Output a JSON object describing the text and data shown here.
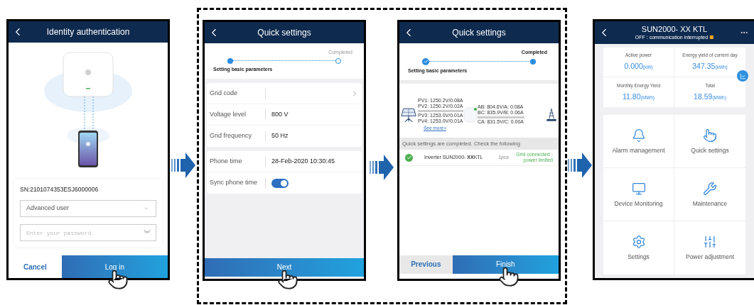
{
  "screens": [
    {
      "kind": "login",
      "title": "Identity authentication",
      "sn": "SN:2101074353ESJ6000006",
      "user_type": "Advanced user",
      "password": {
        "placeholder": "Enter your password."
      },
      "buttons": [
        {
          "label": "Cancel",
          "primary": false,
          "tapped": false
        },
        {
          "label": "Log in",
          "primary": true,
          "tapped": true
        }
      ]
    },
    {
      "kind": "settings",
      "title": "Quick settings",
      "steps": [
        {
          "label": "Setting basic parameters",
          "done": false,
          "active": true
        },
        {
          "label": "Completed",
          "done": false,
          "active": false
        }
      ],
      "groups": [
        {
          "rows": [
            {
              "kind": "link",
              "label": "Grid code"
            },
            {
              "kind": "value",
              "label": "Voltage level",
              "value": "800 V"
            },
            {
              "kind": "value",
              "label": "Grid frequency",
              "value": "50 Hz"
            }
          ]
        },
        {
          "rows": [
            {
              "kind": "value",
              "label": "Phone time",
              "value": "28-Feb-2020 10:30:45"
            },
            {
              "kind": "toggle",
              "label": "Sync phone time",
              "on": true
            }
          ]
        }
      ],
      "buttons": [
        {
          "label": "Next",
          "primary": true,
          "tapped": true
        }
      ]
    },
    {
      "kind": "result",
      "title": "Quick settings",
      "steps": [
        {
          "label": "Setting basic parameters",
          "done": true
        },
        {
          "label": "Completed",
          "done": false,
          "active": true
        }
      ],
      "pv": [
        "PV1: 1250.2V/0.08A",
        "PV2: 1250.2V/0.02A",
        "PV3: 1253.0V/0.01A",
        "PV4: 1253.0V/0.01A"
      ],
      "grid": [
        "AB: 804.6V/A: 0.08A",
        "BC: 835.9V/B: 0.06A",
        "CA: 831.5V/C: 0.00A"
      ],
      "see_more": "See more>",
      "banner": "Quick settings are completed. Check the following",
      "devices": [
        {
          "name": "Inverter SUN2000- **XX**KTL",
          "count": "1pcs",
          "status": "Grid connected - power limited",
          "color": "#4caf50"
        }
      ],
      "buttons": [
        {
          "label": "Previous",
          "primary": false,
          "tapped": false
        },
        {
          "label": "Finish",
          "primary": true,
          "tapped": true
        }
      ]
    },
    {
      "kind": "home",
      "title": "SUN2000- XX KTL",
      "status": {
        "text": "OFF : communication interrupted",
        "color": "#f5a623"
      },
      "stats": [
        {
          "label": "Active power",
          "value": "0.000",
          "unit": "(kW)"
        },
        {
          "label": "Energy yield of current day",
          "value": "347.35",
          "unit": "(kWh)"
        },
        {
          "label": "Monthly Energy Yield",
          "value": "11.80",
          "unit": "(MWh)"
        },
        {
          "label": "Total",
          "value": "18.59",
          "unit": "(MWh)"
        }
      ],
      "tiles": [
        {
          "kind": "alarm",
          "label": "Alarm management"
        },
        {
          "kind": "touch",
          "label": "Quick settings"
        },
        {
          "kind": "monitor",
          "label": "Device Monitoring"
        },
        {
          "kind": "maintenance",
          "label": "Maintenance"
        },
        {
          "kind": "settings",
          "label": "Settings"
        },
        {
          "kind": "power",
          "label": "Power adjustment"
        }
      ]
    }
  ]
}
